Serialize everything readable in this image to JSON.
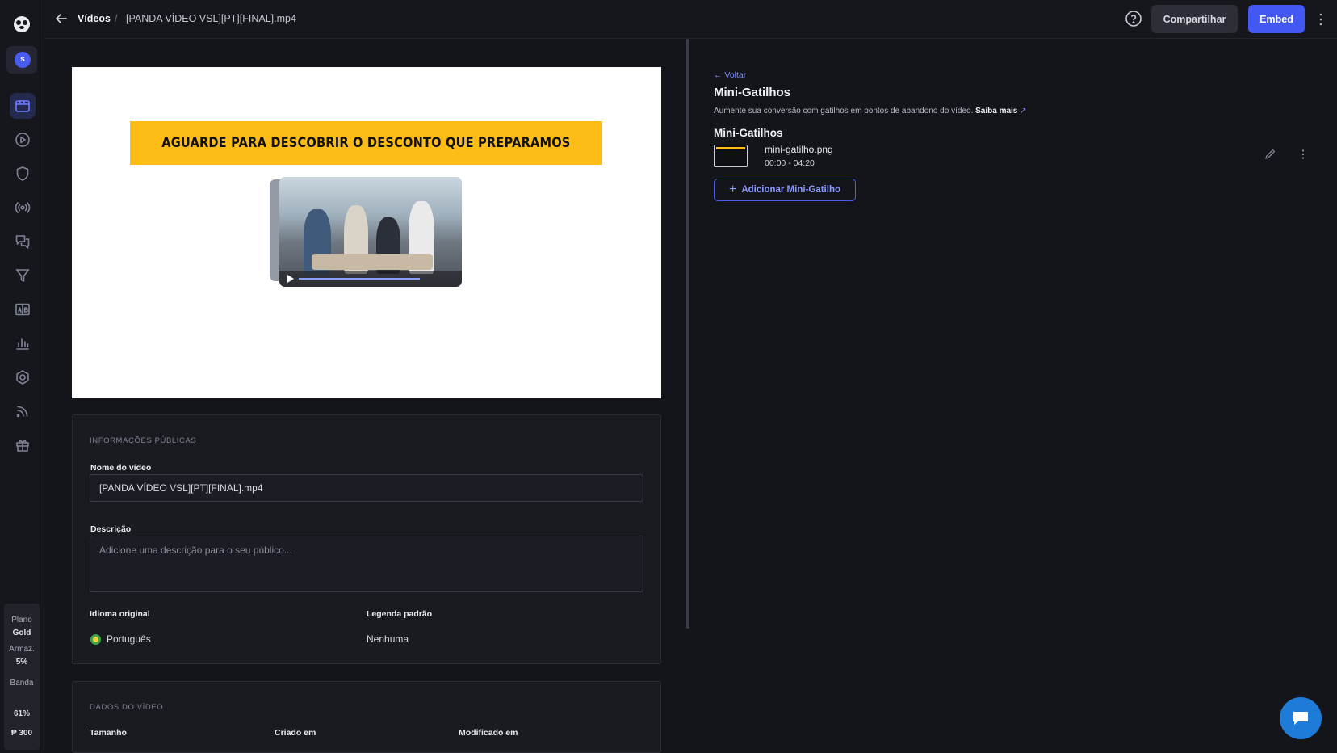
{
  "rail": {
    "avatar_initial": "s",
    "nav_icons": [
      "videos-icon",
      "play-icon",
      "shield-icon",
      "broadcast-icon",
      "comments-icon",
      "funnel-icon",
      "ab-test-icon",
      "analytics-icon",
      "settings-icon",
      "rss-icon",
      "gift-icon"
    ],
    "plan": {
      "plan_label": "Plano",
      "plan_name": "Gold",
      "storage_label": "Armaz.",
      "storage_value": "5%",
      "band_label": "Banda",
      "band_value": "61%",
      "credits": "300"
    }
  },
  "topbar": {
    "crumb_parent": "Vídeos",
    "crumb_separator": "/",
    "crumb_current": "[PANDA VÍDEO VSL][PT][FINAL].mp4",
    "share_label": "Compartilhar",
    "embed_label": "Embed",
    "embed_color": "#4358f3"
  },
  "video": {
    "banner_text": "AGUARDE PARA DESCOBRIR O DESCONTO QUE PREPARAMOS",
    "banner_color": "#fdbd16"
  },
  "public_info": {
    "section_title": "INFORMAÇÕES PÚBLICAS",
    "name_label": "Nome do vídeo",
    "name_value": "[PANDA VÍDEO VSL][PT][FINAL].mp4",
    "description_label": "Descrição",
    "description_placeholder": "Adicione uma descrição para o seu público...",
    "language_label": "Idioma original",
    "language_value": "Português",
    "subtitle_label": "Legenda padrão",
    "subtitle_value": "Nenhuma"
  },
  "video_data": {
    "section_title": "DADOS DO VÍDEO",
    "size_label": "Tamanho",
    "created_label": "Criado em",
    "modified_label": "Modificado em"
  },
  "mini_triggers": {
    "back_label": "← Voltar",
    "title": "Mini-Gatilhos",
    "description": "Aumente sua conversão com gatilhos em pontos de abandono do vídeo.",
    "learn_more": "Saiba mais",
    "list_title": "Mini-Gatilhos",
    "items": [
      {
        "file": "mini-gatilho.png",
        "range": "00:00 - 04:20"
      }
    ],
    "add_label": "Adicionar Mini-Gatilho",
    "accent_color": "#4d5bf0"
  }
}
